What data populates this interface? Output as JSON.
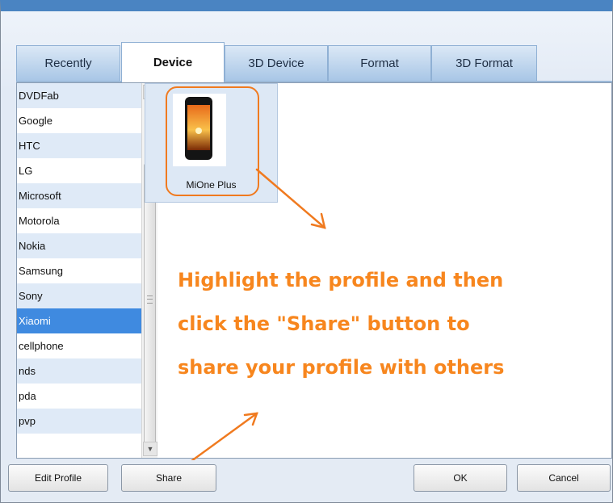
{
  "tabs": [
    {
      "label": "Recently"
    },
    {
      "label": "Device"
    },
    {
      "label": "3D Device"
    },
    {
      "label": "Format"
    },
    {
      "label": "3D Format"
    }
  ],
  "active_tab": "Device",
  "brand_list": [
    {
      "label": "DVDFab"
    },
    {
      "label": "Google"
    },
    {
      "label": "HTC"
    },
    {
      "label": "LG"
    },
    {
      "label": "Microsoft"
    },
    {
      "label": "Motorola"
    },
    {
      "label": "Nokia"
    },
    {
      "label": "Samsung"
    },
    {
      "label": "Sony"
    },
    {
      "label": "Xiaomi"
    },
    {
      "label": "cellphone"
    },
    {
      "label": "nds"
    },
    {
      "label": "pda"
    },
    {
      "label": "pvp"
    }
  ],
  "selected_brand": "Xiaomi",
  "profile": {
    "label": "MiOne Plus",
    "icon": "phone-image"
  },
  "annotation": {
    "lines": [
      "Highlight the profile and then",
      "click the \"Share\" button to",
      "share your profile with others"
    ],
    "color": "#f7861e"
  },
  "buttons": {
    "edit_profile": "Edit Profile",
    "share": "Share",
    "ok": "OK",
    "cancel": "Cancel"
  },
  "colors": {
    "accent": "#f07a1f",
    "selection": "#3f8ae0",
    "title_bar": "#4a84c2"
  }
}
